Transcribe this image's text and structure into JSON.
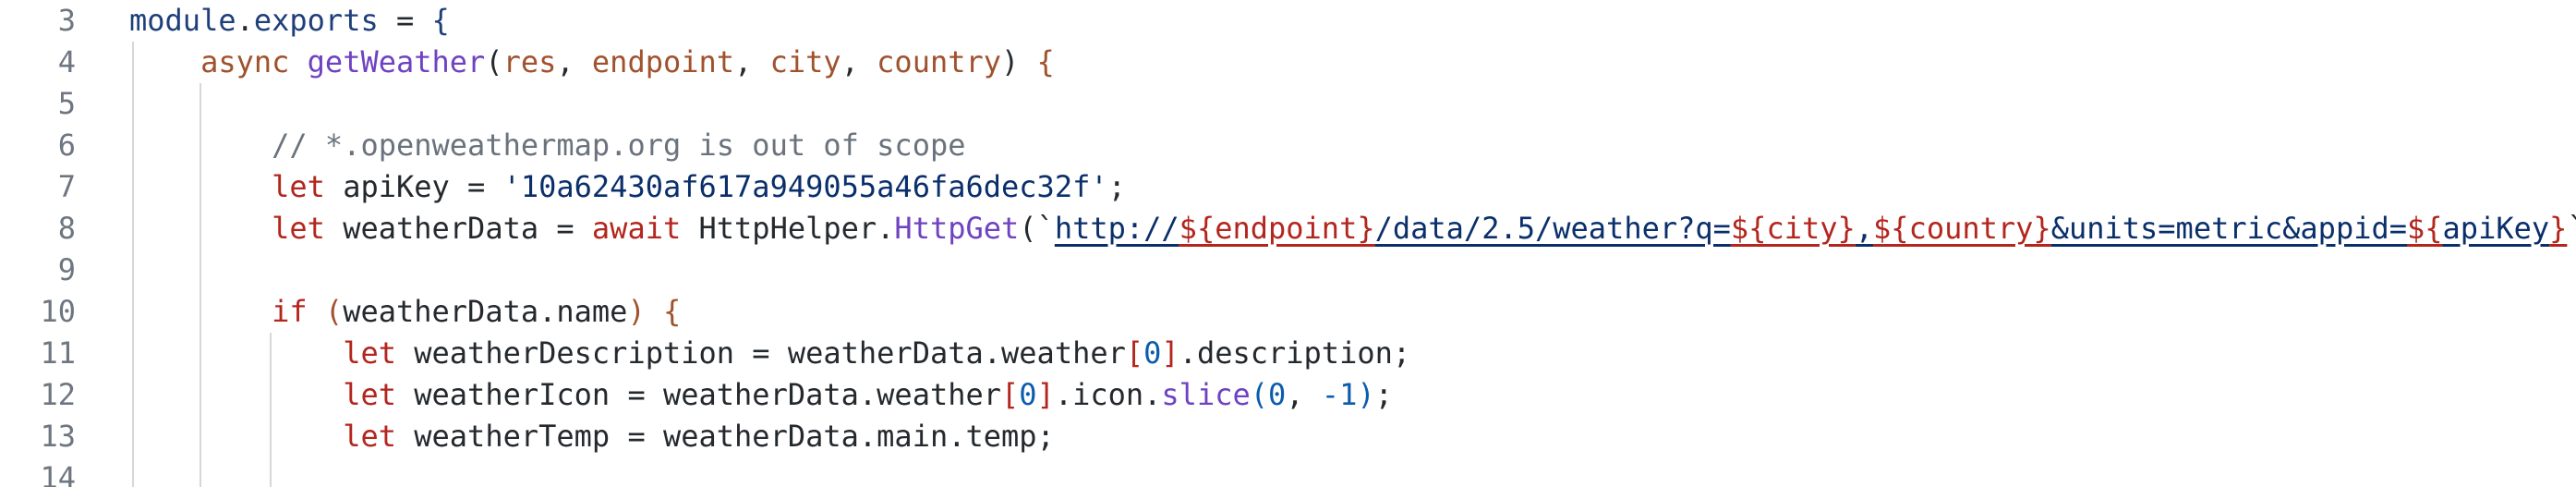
{
  "editor": {
    "lines": [
      {
        "number": "3",
        "segments": [
          {
            "text": "module",
            "cls": "t-prop"
          },
          {
            "text": ".",
            "cls": "t-plain"
          },
          {
            "text": "exports",
            "cls": "t-prop"
          },
          {
            "text": " = ",
            "cls": "t-plain"
          },
          {
            "text": "{",
            "cls": "t-prop"
          }
        ]
      },
      {
        "number": "4",
        "segments": [
          {
            "text": "    ",
            "cls": "t-plain"
          },
          {
            "text": "async",
            "cls": "t-kw2"
          },
          {
            "text": " ",
            "cls": "t-plain"
          },
          {
            "text": "getWeather",
            "cls": "t-fn"
          },
          {
            "text": "(",
            "cls": "t-plain"
          },
          {
            "text": "res",
            "cls": "t-kw2"
          },
          {
            "text": ", ",
            "cls": "t-plain"
          },
          {
            "text": "endpoint",
            "cls": "t-kw2"
          },
          {
            "text": ", ",
            "cls": "t-plain"
          },
          {
            "text": "city",
            "cls": "t-kw2"
          },
          {
            "text": ", ",
            "cls": "t-plain"
          },
          {
            "text": "country",
            "cls": "t-kw2"
          },
          {
            "text": ") ",
            "cls": "t-plain"
          },
          {
            "text": "{",
            "cls": "t-kw2"
          }
        ]
      },
      {
        "number": "5",
        "segments": []
      },
      {
        "number": "6",
        "segments": [
          {
            "text": "        ",
            "cls": "t-plain"
          },
          {
            "text": "// *.openweathermap.org is out of scope",
            "cls": "t-comment"
          }
        ]
      },
      {
        "number": "7",
        "segments": [
          {
            "text": "        ",
            "cls": "t-plain"
          },
          {
            "text": "let",
            "cls": "t-kw"
          },
          {
            "text": " apiKey = ",
            "cls": "t-plain"
          },
          {
            "text": "'10a62430af617a949055a46fa6dec32f'",
            "cls": "t-str"
          },
          {
            "text": ";",
            "cls": "t-plain"
          }
        ]
      },
      {
        "number": "8",
        "segments": [
          {
            "text": "        ",
            "cls": "t-plain"
          },
          {
            "text": "let",
            "cls": "t-kw"
          },
          {
            "text": " weatherData = ",
            "cls": "t-plain"
          },
          {
            "text": "await",
            "cls": "t-kw"
          },
          {
            "text": " HttpHelper.",
            "cls": "t-plain"
          },
          {
            "text": "HttpGet",
            "cls": "t-fn"
          },
          {
            "text": "(`",
            "cls": "t-plain"
          },
          {
            "text": "http://",
            "cls": "t-url"
          },
          {
            "text": "${endpoint}",
            "cls": "t-url-red"
          },
          {
            "text": "/data/2.5/weather?q=",
            "cls": "t-url"
          },
          {
            "text": "${city}",
            "cls": "t-url-red"
          },
          {
            "text": ",",
            "cls": "t-url"
          },
          {
            "text": "${country}",
            "cls": "t-url-red"
          },
          {
            "text": "&units=metric&appid=",
            "cls": "t-url"
          },
          {
            "text": "${",
            "cls": "t-url-red"
          },
          {
            "text": "apiKey",
            "cls": "t-url"
          },
          {
            "text": "}",
            "cls": "t-url-red"
          },
          {
            "text": "`);",
            "cls": "t-plain"
          }
        ]
      },
      {
        "number": "9",
        "segments": []
      },
      {
        "number": "10",
        "segments": [
          {
            "text": "        ",
            "cls": "t-plain"
          },
          {
            "text": "if",
            "cls": "t-kw"
          },
          {
            "text": " ",
            "cls": "t-plain"
          },
          {
            "text": "(",
            "cls": "t-kw2"
          },
          {
            "text": "weatherData.name",
            "cls": "t-plain"
          },
          {
            "text": ")",
            "cls": "t-kw2"
          },
          {
            "text": " ",
            "cls": "t-plain"
          },
          {
            "text": "{",
            "cls": "t-kw2"
          }
        ]
      },
      {
        "number": "11",
        "segments": [
          {
            "text": "            ",
            "cls": "t-plain"
          },
          {
            "text": "let",
            "cls": "t-kw"
          },
          {
            "text": " weatherDescription = weatherData.weather",
            "cls": "t-plain"
          },
          {
            "text": "[",
            "cls": "t-kw"
          },
          {
            "text": "0",
            "cls": "t-num"
          },
          {
            "text": "]",
            "cls": "t-kw"
          },
          {
            "text": ".description;",
            "cls": "t-plain"
          }
        ]
      },
      {
        "number": "12",
        "segments": [
          {
            "text": "            ",
            "cls": "t-plain"
          },
          {
            "text": "let",
            "cls": "t-kw"
          },
          {
            "text": " weatherIcon = weatherData.weather",
            "cls": "t-plain"
          },
          {
            "text": "[",
            "cls": "t-kw"
          },
          {
            "text": "0",
            "cls": "t-num"
          },
          {
            "text": "]",
            "cls": "t-kw"
          },
          {
            "text": ".icon.",
            "cls": "t-plain"
          },
          {
            "text": "slice",
            "cls": "t-fn"
          },
          {
            "text": "(",
            "cls": "t-num"
          },
          {
            "text": "0",
            "cls": "t-num"
          },
          {
            "text": ", ",
            "cls": "t-plain"
          },
          {
            "text": "-1",
            "cls": "t-num"
          },
          {
            "text": ")",
            "cls": "t-num"
          },
          {
            "text": ";",
            "cls": "t-plain"
          }
        ]
      },
      {
        "number": "13",
        "segments": [
          {
            "text": "            ",
            "cls": "t-plain"
          },
          {
            "text": "let",
            "cls": "t-kw"
          },
          {
            "text": " weatherTemp = weatherData.main.temp;",
            "cls": "t-plain"
          }
        ]
      },
      {
        "number": "14",
        "segments": []
      }
    ]
  }
}
